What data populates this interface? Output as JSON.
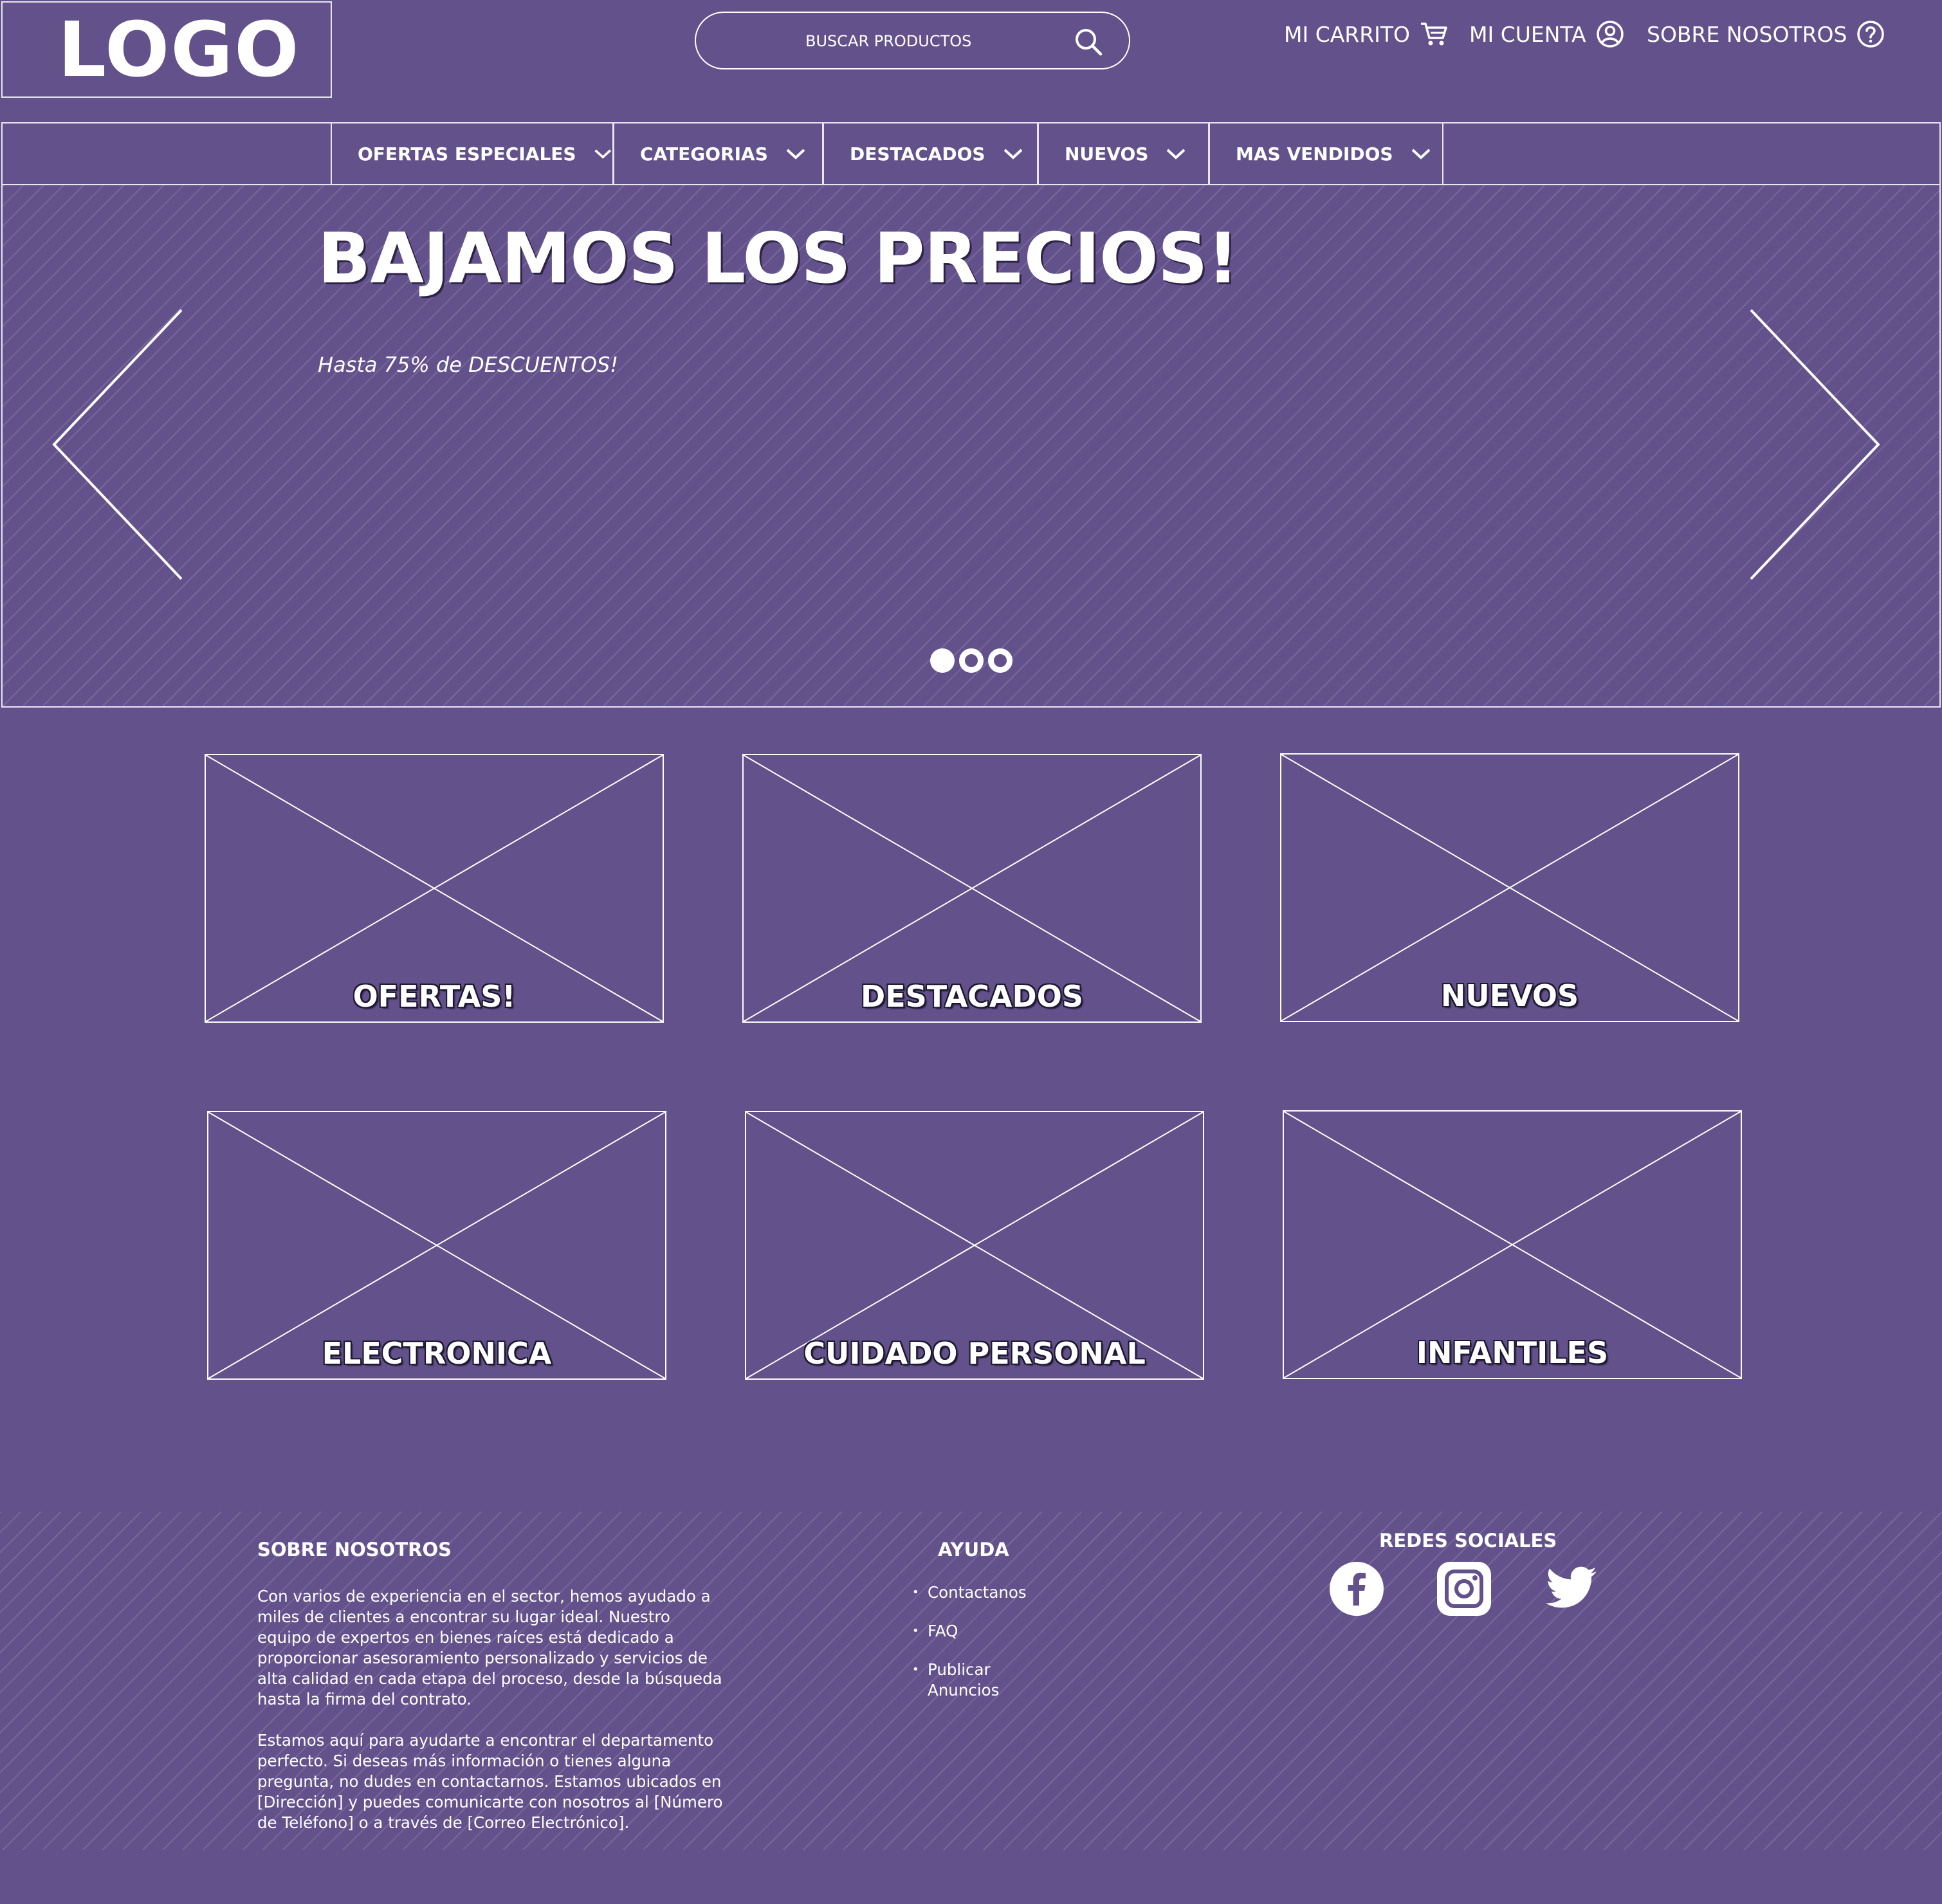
{
  "header": {
    "logo": "LOGO",
    "search_placeholder": "BUSCAR PRODUCTOS",
    "links": [
      {
        "label": "MI CARRITO",
        "icon": "cart-icon"
      },
      {
        "label": "MI CUENTA",
        "icon": "account-icon"
      },
      {
        "label": "SOBRE NOSOTROS",
        "icon": "help-icon"
      }
    ]
  },
  "nav": {
    "items": [
      {
        "label": "OFERTAS ESPECIALES"
      },
      {
        "label": "CATEGORIAS"
      },
      {
        "label": "DESTACADOS"
      },
      {
        "label": "NUEVOS"
      },
      {
        "label": "MAS VENDIDOS"
      }
    ]
  },
  "hero": {
    "title": "BAJAMOS LOS PRECIOS!",
    "subtitle": "Hasta 75% de DESCUENTOS!",
    "slides": 3,
    "active_slide": 1
  },
  "tiles": [
    {
      "label": "OFERTAS!"
    },
    {
      "label": "DESTACADOS"
    },
    {
      "label": "NUEVOS"
    },
    {
      "label": "ELECTRONICA"
    },
    {
      "label": "CUIDADO PERSONAL"
    },
    {
      "label": "INFANTILES"
    }
  ],
  "footer": {
    "about": {
      "heading": "SOBRE NOSOTROS",
      "p1": "Con varios de experiencia en el sector, hemos ayudado a miles de clientes a encontrar su lugar ideal. Nuestro equipo de expertos en bienes raíces está dedicado a proporcionar asesoramiento personalizado y servicios de alta calidad en cada etapa del proceso, desde la búsqueda hasta la firma del contrato.",
      "p2": "Estamos aquí para ayudarte a encontrar el departamento perfecto. Si deseas más información o tienes alguna pregunta, no dudes en contactarnos. Estamos ubicados en [Dirección] y puedes comunicarte con nosotros al [Número de Teléfono] o a través de [Correo Electrónico]."
    },
    "help": {
      "heading": "AYUDA",
      "items": [
        "Contactanos",
        "FAQ",
        "Publicar Anuncios"
      ]
    },
    "social": {
      "heading": "REDES SOCIALES",
      "icons": [
        "facebook-icon",
        "instagram-icon",
        "twitter-icon"
      ]
    }
  },
  "colors": {
    "background": "#63518b",
    "foreground": "#ffffff"
  }
}
